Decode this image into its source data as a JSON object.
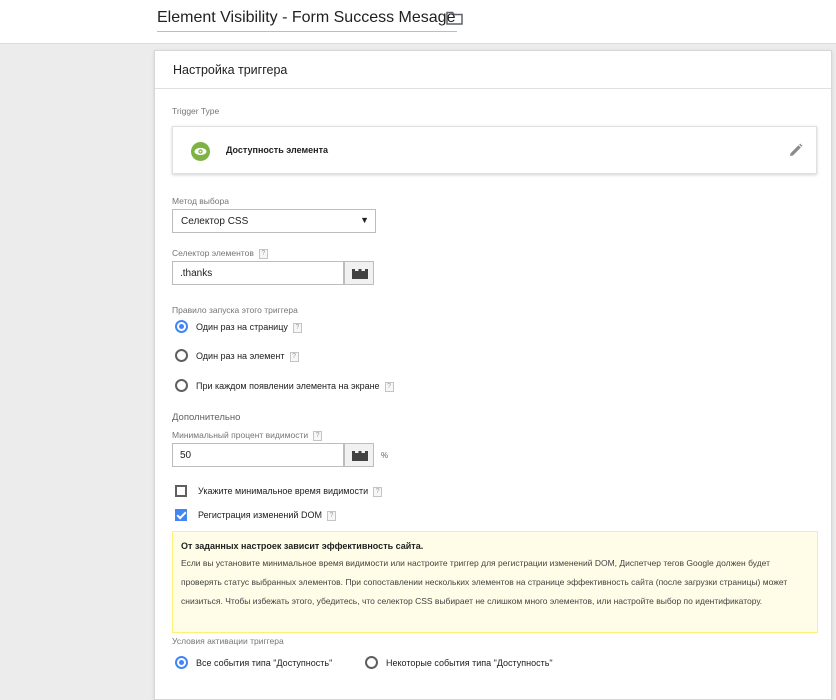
{
  "header": {
    "title": "Element Visibility - Form Success Mesage",
    "folder_icon": "folder-icon"
  },
  "panel": {
    "heading": "Настройка триггера",
    "trigger_type_label": "Trigger Type",
    "trigger_type_name": "Доступность элемента",
    "trigger_icon": "eye-icon",
    "edit_icon": "pencil-icon",
    "selection_method_label": "Метод выбора",
    "selection_method_value": "Селектор CSS",
    "element_selector_label": "Селектор элементов",
    "element_selector_value": ".thanks",
    "fire_rule_label": "Правило запуска этого триггера",
    "fire_options": [
      {
        "label": "Один раз на страницу",
        "selected": true
      },
      {
        "label": "Один раз на элемент",
        "selected": false
      },
      {
        "label": "При каждом появлении элемента на экране",
        "selected": false
      }
    ],
    "advanced_label": "Дополнительно",
    "min_percent_label": "Минимальный процент видимости",
    "min_percent_value": "50",
    "percent_unit": "%",
    "checkboxes": [
      {
        "label": "Укажите минимальное время видимости",
        "checked": false
      },
      {
        "label": "Регистрация изменений DOM",
        "checked": true
      }
    ],
    "warning": {
      "title": "От заданных настроек зависит эффективность сайта.",
      "body": "Если вы установите минимальное время видимости или настроите триггер для регистрации изменений DOM, Диспетчер тегов Google должен будет проверять статус выбранных элементов. При сопоставлении нескольких элементов на странице эффективность сайта (после загрузки страницы) может снизиться. Чтобы избежать этого, убедитесь, что селектор CSS выбирает не слишком много элементов, или настройте выбор по идентификатору."
    },
    "activation_label": "Условия активации триггера",
    "activation_options": [
      {
        "label": "Все события типа \"Доступность\"",
        "selected": true
      },
      {
        "label": "Некоторые события типа \"Доступность\"",
        "selected": false
      }
    ],
    "help_mark": "?",
    "colors": {
      "accent": "#4285f4",
      "trigger_icon_bg": "#7cb342",
      "warning_bg": "#fffde7"
    }
  }
}
